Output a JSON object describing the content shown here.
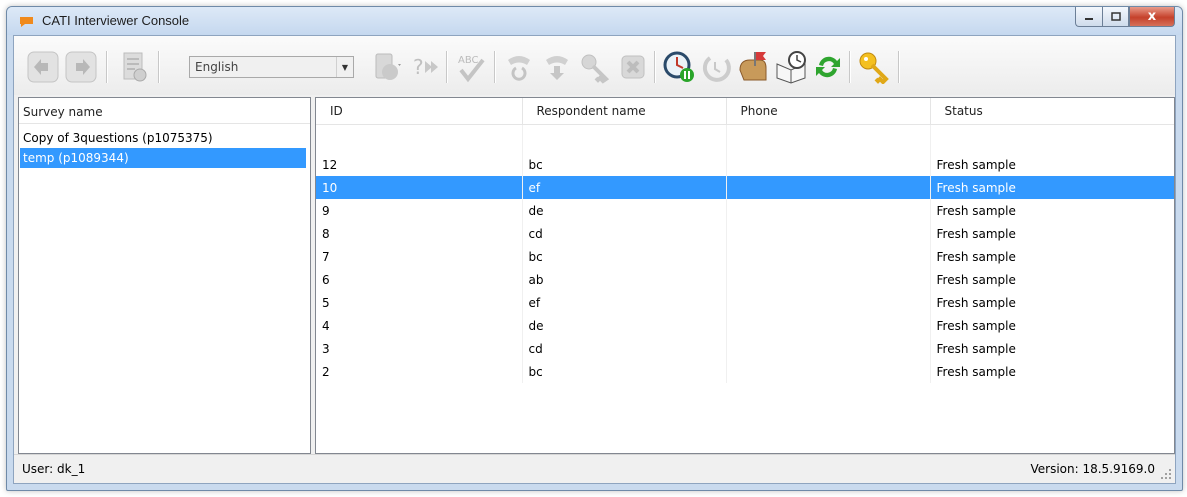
{
  "window": {
    "title": "CATI Interviewer Console",
    "caption_close": "x"
  },
  "toolbar": {
    "language": "English"
  },
  "surveys": {
    "header": "Survey name",
    "items": [
      {
        "label": "Copy of 3questions (p1075375)",
        "selected": false
      },
      {
        "label": "temp (p1089344)",
        "selected": true
      }
    ]
  },
  "respondents": {
    "columns": [
      "ID",
      "Respondent name",
      "Phone",
      "Status"
    ],
    "rows": [
      {
        "id": "12",
        "name": "bc",
        "phone": "",
        "status": "Fresh sample"
      },
      {
        "id": "10",
        "name": "ef",
        "phone": "",
        "status": "Fresh sample"
      },
      {
        "id": "9",
        "name": "de",
        "phone": "",
        "status": "Fresh sample"
      },
      {
        "id": "8",
        "name": "cd",
        "phone": "",
        "status": "Fresh sample"
      },
      {
        "id": "7",
        "name": "bc",
        "phone": "",
        "status": "Fresh sample"
      },
      {
        "id": "6",
        "name": "ab",
        "phone": "",
        "status": "Fresh sample"
      },
      {
        "id": "5",
        "name": "ef",
        "phone": "",
        "status": "Fresh sample"
      },
      {
        "id": "4",
        "name": "de",
        "phone": "",
        "status": "Fresh sample"
      },
      {
        "id": "3",
        "name": "cd",
        "phone": "",
        "status": "Fresh sample"
      },
      {
        "id": "2",
        "name": "bc",
        "phone": "",
        "status": "Fresh sample"
      }
    ],
    "selected_index": 1
  },
  "status": {
    "user": "User:  dk_1",
    "version": "Version:  18.5.9169.0"
  },
  "colors": {
    "selection": "#3399ff",
    "app_icon": "#f08a1c",
    "close_button": "#c5412b"
  }
}
